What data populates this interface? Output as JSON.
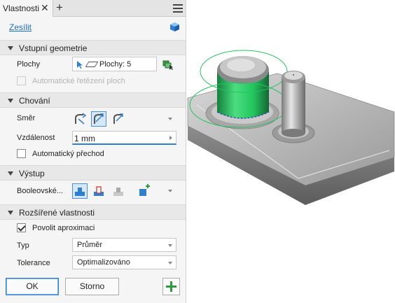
{
  "panel": {
    "tab_label": "Vlastnosti",
    "link_label": "Zesílit"
  },
  "sections": {
    "input": "Vstupní geometrie",
    "behavior": "Chování",
    "output": "Výstup",
    "advanced": "Rozšířené vlastnosti"
  },
  "input_geometry": {
    "faces_label": "Plochy",
    "faces_value": "Plochy: 5",
    "auto_chain_label": "Automatické řetězení ploch"
  },
  "behavior": {
    "direction_label": "Směr",
    "distance_label": "Vzdálenost",
    "distance_value": "1 mm",
    "auto_blend_label": "Automatický přechod"
  },
  "output": {
    "boolean_label": "Booleovské..."
  },
  "advanced": {
    "allow_approx_label": "Povolit aproximaci",
    "type_label": "Typ",
    "type_value": "Průměr",
    "tolerance_label": "Tolerance",
    "tolerance_value": "Optimalizováno"
  },
  "buttons": {
    "ok": "OK",
    "cancel": "Storno"
  },
  "colors": {
    "accent": "#2f7fd0",
    "add_green": "#2e9b3a",
    "highlight_green": "#22c55e"
  }
}
